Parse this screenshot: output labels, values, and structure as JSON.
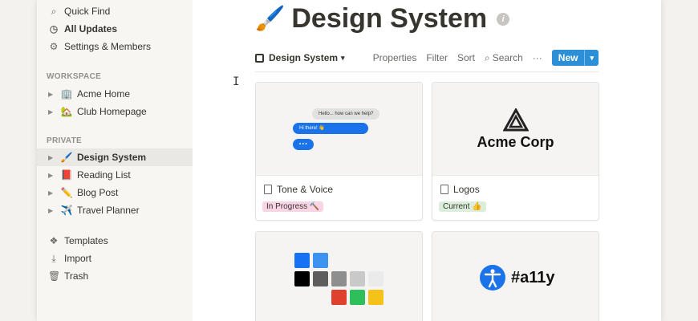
{
  "sidebar": {
    "top_items": [
      {
        "icon": "search-icon",
        "glyph": "⌕",
        "label": "Quick Find"
      },
      {
        "icon": "clock-icon",
        "glyph": "◷",
        "label": "All Updates"
      },
      {
        "icon": "gear-icon",
        "glyph": "⚙",
        "label": "Settings & Members"
      }
    ],
    "workspace_label": "WORKSPACE",
    "workspace_pages": [
      {
        "emoji": "🏢",
        "label": "Acme Home"
      },
      {
        "emoji": "🏡",
        "label": "Club Homepage"
      }
    ],
    "private_label": "PRIVATE",
    "private_pages": [
      {
        "emoji": "🖌️",
        "label": "Design System"
      },
      {
        "emoji": "📕",
        "label": "Reading List"
      },
      {
        "emoji": "✏️",
        "label": "Blog Post"
      },
      {
        "emoji": "✈️",
        "label": "Travel Planner"
      }
    ],
    "bottom_items": [
      {
        "icon": "templates-icon",
        "glyph": "❖",
        "label": "Templates"
      },
      {
        "icon": "import-icon",
        "glyph": "⤓",
        "label": "Import"
      },
      {
        "icon": "trash-icon",
        "glyph": "🗑",
        "label": "Trash"
      }
    ]
  },
  "page": {
    "emoji": "🖌️",
    "title": "Design System",
    "info_glyph": "i"
  },
  "toolbar": {
    "view_label": "Design System",
    "properties": "Properties",
    "filter": "Filter",
    "sort": "Sort",
    "search": "Search",
    "more": "···",
    "new_label": "New",
    "new_dropdown": "⌄"
  },
  "cards": [
    {
      "name": "Tone & Voice",
      "tag": "In Progress 🔨",
      "tag_bg": "#f9d4e4",
      "chat": {
        "incoming": "Hello... how can we help?",
        "outgoing": "Hi there! 👋",
        "typing": "• • •"
      }
    },
    {
      "name": "Logos",
      "tag": "Current 👍",
      "tag_bg": "#dbeddb",
      "logo_text": "Acme Corp"
    },
    {
      "swatches": [
        "#1672f2",
        "#3d93f0",
        "#000000",
        "#5d5d5d",
        "#8e8e8e",
        "#c9c9c9",
        "#ebebeb",
        "#e0412f",
        "#2fbf5a",
        "#f5c21a"
      ]
    },
    {
      "a11y_text": "#a11y"
    }
  ],
  "colors": {
    "accent": "#2d8fd5",
    "sidebar_bg": "#f7f6f3"
  }
}
